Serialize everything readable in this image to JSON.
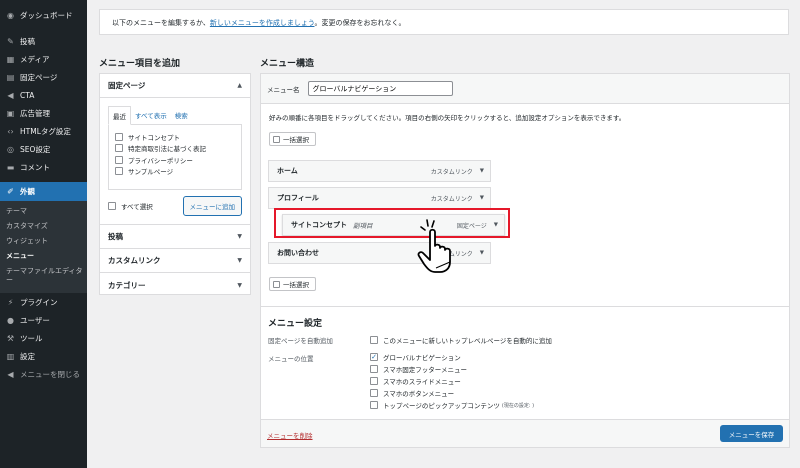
{
  "sidebar": {
    "items": [
      {
        "icon": "dashboard-icon",
        "glyph": "◉",
        "label": "ダッシュボード"
      },
      {
        "icon": "pin-icon",
        "glyph": "✎",
        "label": "投稿"
      },
      {
        "icon": "media-icon",
        "glyph": "▦",
        "label": "メディア"
      },
      {
        "icon": "page-icon",
        "glyph": "▤",
        "label": "固定ページ"
      },
      {
        "icon": "megaphone-icon",
        "glyph": "◀",
        "label": "CTA"
      },
      {
        "icon": "ad-icon",
        "glyph": "▣",
        "label": "広告管理"
      },
      {
        "icon": "code-icon",
        "glyph": "‹›",
        "label": "HTMLタグ設定"
      },
      {
        "icon": "seo-icon",
        "glyph": "◎",
        "label": "SEO設定"
      },
      {
        "icon": "comment-icon",
        "glyph": "▬",
        "label": "コメント"
      },
      {
        "icon": "brush-icon",
        "glyph": "✐",
        "label": "外観"
      },
      {
        "icon": "plugin-icon",
        "glyph": "⚡",
        "label": "プラグイン"
      },
      {
        "icon": "user-icon",
        "glyph": "●",
        "label": "ユーザー"
      },
      {
        "icon": "wrench-icon",
        "glyph": "⚒",
        "label": "ツール"
      },
      {
        "icon": "settings-icon",
        "glyph": "▥",
        "label": "設定"
      },
      {
        "icon": "collapse-icon",
        "glyph": "◀",
        "label": "メニューを閉じる"
      }
    ],
    "submenu": [
      "テーマ",
      "カスタマイズ",
      "ウィジェット",
      "メニュー",
      "テーマファイルエディター"
    ]
  },
  "notice": {
    "before": "以下のメニューを編集するか、",
    "link": "新しいメニューを作成しましょう",
    "after": "。変更の保存をお忘れなく。"
  },
  "left": {
    "title": "メニュー項目を追加",
    "pages_header": "固定ページ",
    "tabs": [
      "最近",
      "すべて表示",
      "検索"
    ],
    "pages": [
      "サイトコンセプト",
      "特定商取引法に基づく表記",
      "プライバシーポリシー",
      "サンプルページ"
    ],
    "select_all": "すべて選択",
    "add_button": "メニューに追加",
    "sections": [
      "投稿",
      "カスタムリンク",
      "カテゴリー"
    ]
  },
  "right": {
    "title": "メニュー構造",
    "name_label": "メニュー名",
    "name_value": "グローバルナビゲーション",
    "instructions": "好みの順番に各項目をドラッグしてください。項目の右側の矢印をクリックすると、追加設定オプションを表示できます。",
    "bulk_select": "一括選択",
    "items": [
      {
        "title": "ホーム",
        "sub": "",
        "type": "カスタムリンク"
      },
      {
        "title": "プロフィール",
        "sub": "",
        "type": "カスタムリンク"
      },
      {
        "title": "サイトコンセプト",
        "sub": "副項目",
        "type": "固定ページ"
      },
      {
        "title": "お問い合わせ",
        "sub": "",
        "type": "カスタムリンク"
      }
    ],
    "settings": {
      "title": "メニュー設定",
      "auto_add_label": "固定ページを自動追加",
      "auto_add_option": "このメニューに新しいトップレベルページを自動的に追加",
      "location_label": "メニューの位置",
      "locations": [
        {
          "label": "グローバルナビゲーション",
          "checked": true,
          "note": ""
        },
        {
          "label": "スマホ固定フッターメニュー",
          "checked": false,
          "note": ""
        },
        {
          "label": "スマホのスライドメニュー",
          "checked": false,
          "note": ""
        },
        {
          "label": "スマホのボタンメニュー",
          "checked": false,
          "note": ""
        },
        {
          "label": "トップページのピックアップコンテンツ",
          "checked": false,
          "note": "(現在の設定: )"
        }
      ]
    },
    "delete_link": "メニューを削除",
    "save_button": "メニューを保存"
  },
  "colors": {
    "accent": "#2271b1",
    "highlight": "#e5182a",
    "sidebar": "#1d2327"
  }
}
